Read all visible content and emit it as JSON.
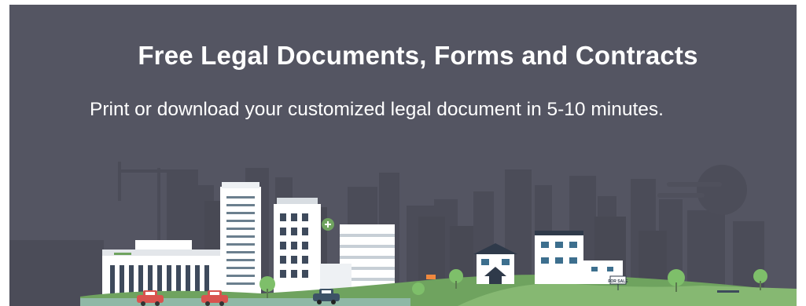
{
  "hero": {
    "title": "Free Legal Documents, Forms and Contracts",
    "subtitle": "Print or download your customized legal document in 5-10 minutes.",
    "background_color": "#545562"
  },
  "illustration": {
    "for_sale_sign": "FOR SALE",
    "colors": {
      "skyline_far": "#4c4d59",
      "skyline_near": "#474853",
      "building_white": "#ffffff",
      "window_blue": "#3d6f8e",
      "ground_green": "#6fa35f",
      "road": "#8fb8a6",
      "car_red": "#d9534f",
      "car_dark": "#3d5266",
      "tree": "#7ebf6a"
    }
  }
}
